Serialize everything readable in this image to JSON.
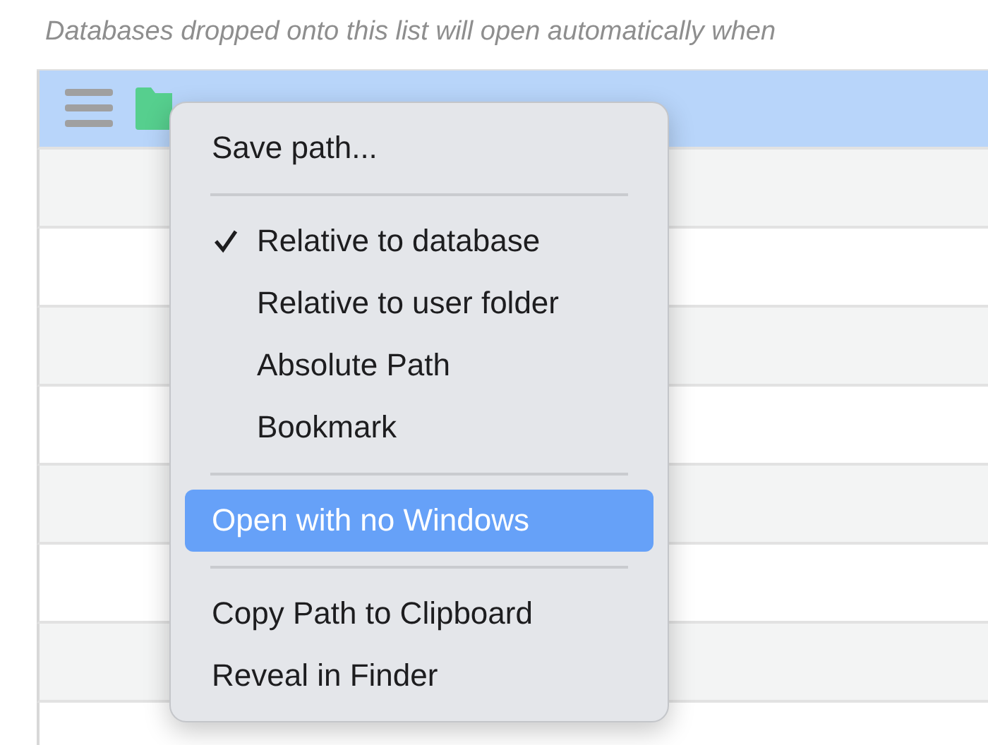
{
  "caption": "Databases dropped onto this list will open automatically when",
  "list": {
    "rows": [
      {
        "selected": true,
        "kind": "database"
      },
      {
        "selected": false,
        "kind": "empty"
      },
      {
        "selected": false,
        "kind": "empty"
      },
      {
        "selected": false,
        "kind": "empty"
      },
      {
        "selected": false,
        "kind": "empty"
      },
      {
        "selected": false,
        "kind": "empty"
      },
      {
        "selected": false,
        "kind": "empty"
      },
      {
        "selected": false,
        "kind": "empty"
      },
      {
        "selected": false,
        "kind": "empty"
      }
    ]
  },
  "context_menu": {
    "items": [
      {
        "kind": "item",
        "label": "Save path...",
        "selected": false
      },
      {
        "kind": "separator"
      },
      {
        "kind": "option",
        "label": "Relative to database",
        "checked": true,
        "selected": false
      },
      {
        "kind": "option",
        "label": "Relative to user folder",
        "checked": false,
        "selected": false
      },
      {
        "kind": "option",
        "label": "Absolute Path",
        "checked": false,
        "selected": false
      },
      {
        "kind": "option",
        "label": "Bookmark",
        "checked": false,
        "selected": false
      },
      {
        "kind": "separator"
      },
      {
        "kind": "item",
        "label": "Open with no Windows",
        "selected": true
      },
      {
        "kind": "separator"
      },
      {
        "kind": "item",
        "label": "Copy Path to Clipboard",
        "selected": false
      },
      {
        "kind": "item",
        "label": "Reveal in Finder",
        "selected": false
      }
    ]
  }
}
